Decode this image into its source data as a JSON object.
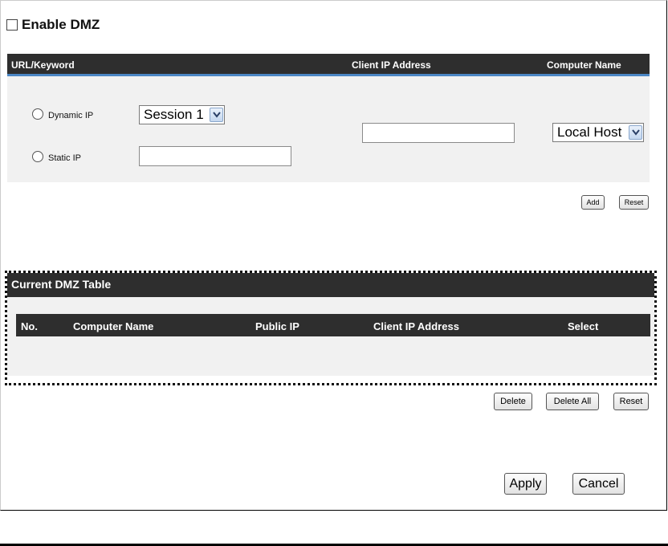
{
  "enable_dmz": {
    "label": "Enable DMZ",
    "checked": false
  },
  "form_header": {
    "col_url": "URL/Keyword",
    "col_client_ip": "Client IP Address",
    "col_computer_name": "Computer Name"
  },
  "form": {
    "dynamic_ip_label": "Dynamic IP",
    "static_ip_label": "Static IP",
    "session_select_value": "Session 1",
    "static_ip_value": "",
    "client_ip_value": "",
    "computer_select_value": "Local Host"
  },
  "form_buttons": {
    "add": "Add",
    "reset": "Reset"
  },
  "dmz_table": {
    "title": "Current DMZ Table",
    "columns": [
      "No.",
      "Computer Name",
      "Public IP",
      "Client IP Address",
      "Select"
    ],
    "rows": []
  },
  "table_buttons": {
    "delete": "Delete",
    "delete_all": "Delete All",
    "reset": "Reset"
  },
  "footer_buttons": {
    "apply": "Apply",
    "cancel": "Cancel"
  }
}
